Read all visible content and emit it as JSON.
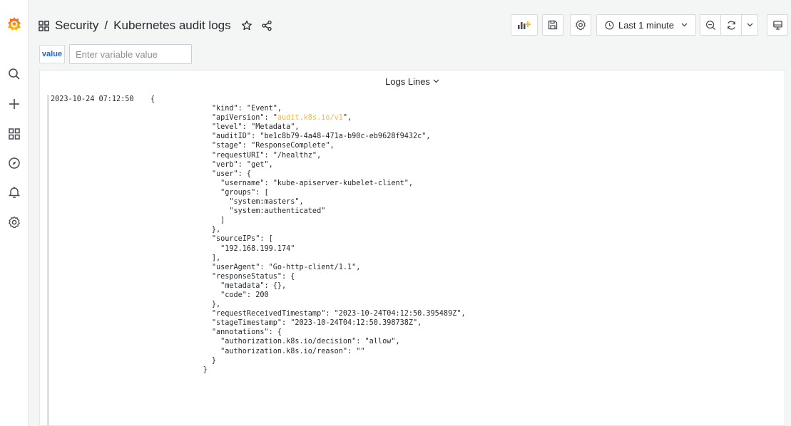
{
  "breadcrumb": {
    "folder": "Security",
    "separator": "/",
    "dashboard": "Kubernetes audit logs"
  },
  "toolbar": {
    "time_range": "Last 1 minute"
  },
  "variables": {
    "label": "value",
    "placeholder": "Enter variable value"
  },
  "panel": {
    "title": "Logs Lines"
  },
  "log": {
    "timestamp": "2023-10-24 07:12:50",
    "lines": [
      "{",
      "    \"kind\": \"Event\",",
      "    \"apiVersion\": \"audit.k8s.io/v1\",",
      "    \"level\": \"Metadata\",",
      "    \"auditID\": \"be1c8b79-4a48-471a-b90c-eb9628f9432c\",",
      "    \"stage\": \"ResponseComplete\",",
      "    \"requestURI\": \"/healthz\",",
      "    \"verb\": \"get\",",
      "    \"user\": {",
      "      \"username\": \"kube-apiserver-kubelet-client\",",
      "      \"groups\": [",
      "        \"system:masters\",",
      "        \"system:authenticated\"",
      "      ]",
      "    },",
      "    \"sourceIPs\": [",
      "      \"192.168.199.174\"",
      "    ],",
      "    \"userAgent\": \"Go-http-client/1.1\",",
      "    \"responseStatus\": {",
      "      \"metadata\": {},",
      "      \"code\": 200",
      "    },",
      "    \"requestReceivedTimestamp\": \"2023-10-24T04:12:50.395489Z\",",
      "    \"stageTimestamp\": \"2023-10-24T04:12:50.398738Z\",",
      "    \"annotations\": {",
      "      \"authorization.k8s.io/decision\": \"allow\",",
      "      \"authorization.k8s.io/reason\": \"\"",
      "    }",
      "  }"
    ],
    "highlight_value": "audit.k8s.io/v1"
  },
  "icons": {
    "sidebar": [
      "grafana-logo",
      "search-icon",
      "plus-icon",
      "dashboards-icon",
      "explore-icon",
      "alerting-icon",
      "settings-icon"
    ],
    "toolbar": [
      "add-panel-icon",
      "save-icon",
      "gear-icon",
      "clock-icon",
      "chevron-down-icon",
      "zoom-out-icon",
      "refresh-icon",
      "chevron-down-icon",
      "tv-mode-icon"
    ]
  },
  "colors": {
    "accent": "#1f62e0",
    "logo_orange": "#f05a28",
    "highlight": "#f2b94b"
  }
}
